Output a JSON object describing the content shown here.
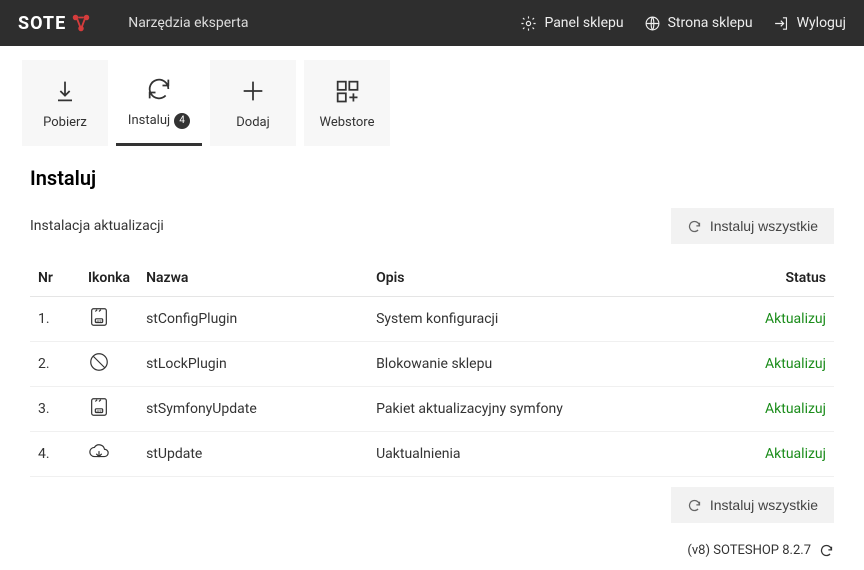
{
  "header": {
    "logo_text": "SOTE",
    "subtitle": "Narzędzia eksperta",
    "links": {
      "panel": "Panel sklepu",
      "strona": "Strona sklepu",
      "logout": "Wyloguj"
    }
  },
  "tabs": {
    "pobierz": "Pobierz",
    "instaluj": "Instaluj",
    "instaluj_badge": "4",
    "dodaj": "Dodaj",
    "webstore": "Webstore"
  },
  "page": {
    "title": "Instaluj",
    "subtitle": "Instalacja aktualizacji",
    "install_all": "Instaluj wszystkie"
  },
  "table": {
    "headers": {
      "nr": "Nr",
      "ikonka": "Ikonka",
      "nazwa": "Nazwa",
      "opis": "Opis",
      "status": "Status"
    },
    "rows": [
      {
        "nr": "1.",
        "name": "stConfigPlugin",
        "desc": "System konfiguracji",
        "status": "Aktualizuj",
        "icon": "app"
      },
      {
        "nr": "2.",
        "name": "stLockPlugin",
        "desc": "Blokowanie sklepu",
        "status": "Aktualizuj",
        "icon": "ban"
      },
      {
        "nr": "3.",
        "name": "stSymfonyUpdate",
        "desc": "Pakiet aktualizacyjny symfony",
        "status": "Aktualizuj",
        "icon": "app"
      },
      {
        "nr": "4.",
        "name": "stUpdate",
        "desc": "Uaktualnienia",
        "status": "Aktualizuj",
        "icon": "cloud"
      }
    ]
  },
  "footer": {
    "version": "(v8) SOTESHOP 8.2.7"
  }
}
